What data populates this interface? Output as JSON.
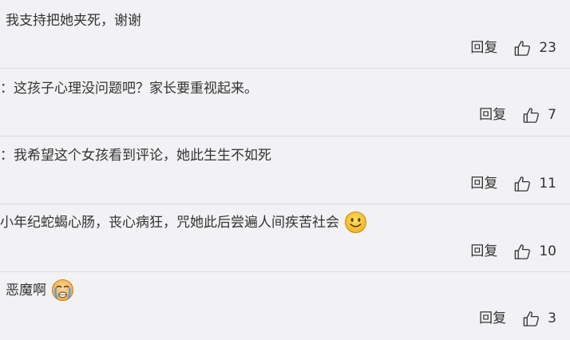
{
  "comments": [
    {
      "text": "我支持把她夹死，谢谢",
      "emoji": "",
      "reply_label": "回复",
      "likes": "23"
    },
    {
      "text": "：这孩子心理没问题吧？家长要重视起来。",
      "emoji": "",
      "reply_label": "回复",
      "likes": "7"
    },
    {
      "text": "：我希望这个女孩看到评论，她此生生不如死",
      "emoji": "",
      "reply_label": "回复",
      "likes": "11"
    },
    {
      "text": "小年纪蛇蝎心肠，丧心病狂，咒她此后尝遍人间疾苦社会",
      "emoji": "smile-face",
      "reply_label": "回复",
      "likes": "10"
    },
    {
      "text": "恶魔啊",
      "emoji": "crying-face",
      "reply_label": "回复",
      "likes": "3"
    }
  ],
  "colors": {
    "background": "#f2f2f4",
    "divider": "#dcdcdf",
    "text": "#333333",
    "emoji_yellow": "#f7c62b"
  }
}
